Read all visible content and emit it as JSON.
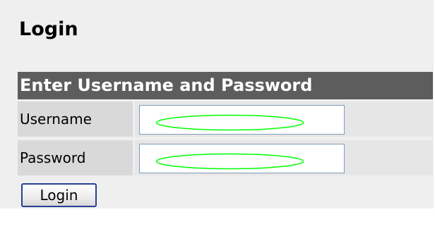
{
  "page": {
    "title": "Login"
  },
  "form": {
    "header": "Enter Username and Password",
    "fields": [
      {
        "label": "Username",
        "value": "",
        "placeholder": "",
        "type": "text"
      },
      {
        "label": "Password",
        "value": "",
        "placeholder": "",
        "type": "password"
      }
    ],
    "submit_label": "Login"
  },
  "colors": {
    "panel_background": "#efefef",
    "header_background": "#5d5d5d",
    "header_text": "#ffffff",
    "label_cell_background": "#d9d9d9",
    "input_cell_background": "#e6e6e6",
    "input_border": "#7f9db9",
    "button_border": "#27418e",
    "field_highlight": "#00ff00"
  }
}
